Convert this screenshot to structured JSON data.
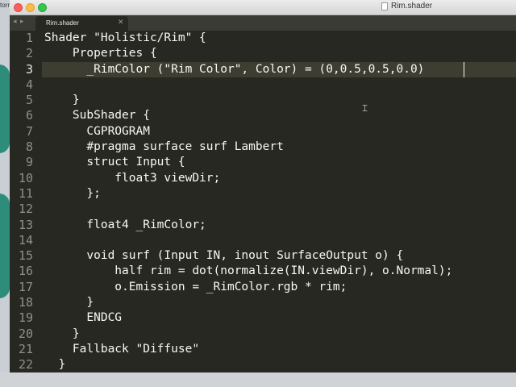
{
  "background_app": {
    "label": "torre"
  },
  "window": {
    "title": "Rim.shader"
  },
  "tabbar": {
    "back_glyph": "◂",
    "forward_glyph": "▸",
    "tab_label": "Rim.shader",
    "close_glyph": "✕"
  },
  "editor": {
    "current_line": 3,
    "line_numbers": [
      "1",
      "2",
      "3",
      "4",
      "5",
      "6",
      "7",
      "8",
      "9",
      "10",
      "11",
      "12",
      "13",
      "14",
      "15",
      "16",
      "17",
      "18",
      "19",
      "20",
      "21",
      "22"
    ],
    "lines": [
      "Shader \"Holistic/Rim\" {",
      "    Properties {",
      "      _RimColor (\"Rim Color\", Color) = (0,0.5,0.5,0.0)",
      "",
      "    }",
      "    SubShader {",
      "      CGPROGRAM",
      "      #pragma surface surf Lambert",
      "      struct Input {",
      "          float3 viewDir;",
      "      };",
      "",
      "      float4 _RimColor;",
      "",
      "      void surf (Input IN, inout SurfaceOutput o) {",
      "          half rim = dot(normalize(IN.viewDir), o.Normal);",
      "          o.Emission = _RimColor.rgb * rim;",
      "      }",
      "      ENDCG",
      "    }",
      "    Fallback \"Diffuse\"",
      "  }"
    ]
  },
  "colors": {
    "editor_bg": "#272822",
    "text": "#f8f8f2",
    "gutter_text": "#8f908a",
    "current_line_bg": "#3e3d32"
  },
  "icons": [
    "close-window-icon",
    "minimize-window-icon",
    "maximize-window-icon",
    "file-icon",
    "back-arrow-icon",
    "forward-arrow-icon",
    "tab-close-icon",
    "mouse-pointer-icon"
  ]
}
